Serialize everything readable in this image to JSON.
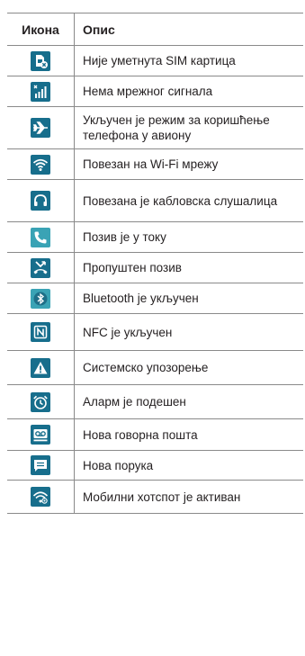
{
  "header": {
    "icon_col": "Икона",
    "desc_col": "Опис"
  },
  "rows": [
    {
      "icon": "no-sim-icon",
      "bg": "#176e8c",
      "text": "Није уметнута SIM картица"
    },
    {
      "icon": "no-signal-icon",
      "bg": "#176e8c",
      "text": "Нема мрежног сигнала"
    },
    {
      "icon": "airplane-icon",
      "bg": "#176e8c",
      "text": "Укључен је режим за коришћење телефона у авиону"
    },
    {
      "icon": "wifi-icon",
      "bg": "#176e8c",
      "text": "Повезан на Wi-Fi мрежу"
    },
    {
      "icon": "headset-icon",
      "bg": "#176e8c",
      "text": "Повезана је кабловска слушалица"
    },
    {
      "icon": "call-icon",
      "bg": "#3aa3b5",
      "text": "Позив је у току"
    },
    {
      "icon": "missed-call-icon",
      "bg": "#176e8c",
      "text": "Пропуштен позив"
    },
    {
      "icon": "bluetooth-icon",
      "bg": "#3aa3b5",
      "text": "Bluetooth је укључен"
    },
    {
      "icon": "nfc-icon",
      "bg": "#176e8c",
      "text": "NFC је укључен"
    },
    {
      "icon": "warning-icon",
      "bg": "#176e8c",
      "text": "Системско упозорење"
    },
    {
      "icon": "alarm-icon",
      "bg": "#176e8c",
      "text": "Аларм је подешен"
    },
    {
      "icon": "voicemail-icon",
      "bg": "#176e8c",
      "text": "Нова говорна пошта"
    },
    {
      "icon": "message-icon",
      "bg": "#176e8c",
      "text": "Нова порука"
    },
    {
      "icon": "hotspot-icon",
      "bg": "#176e8c",
      "text": "Мобилни хотспот је активан"
    }
  ]
}
